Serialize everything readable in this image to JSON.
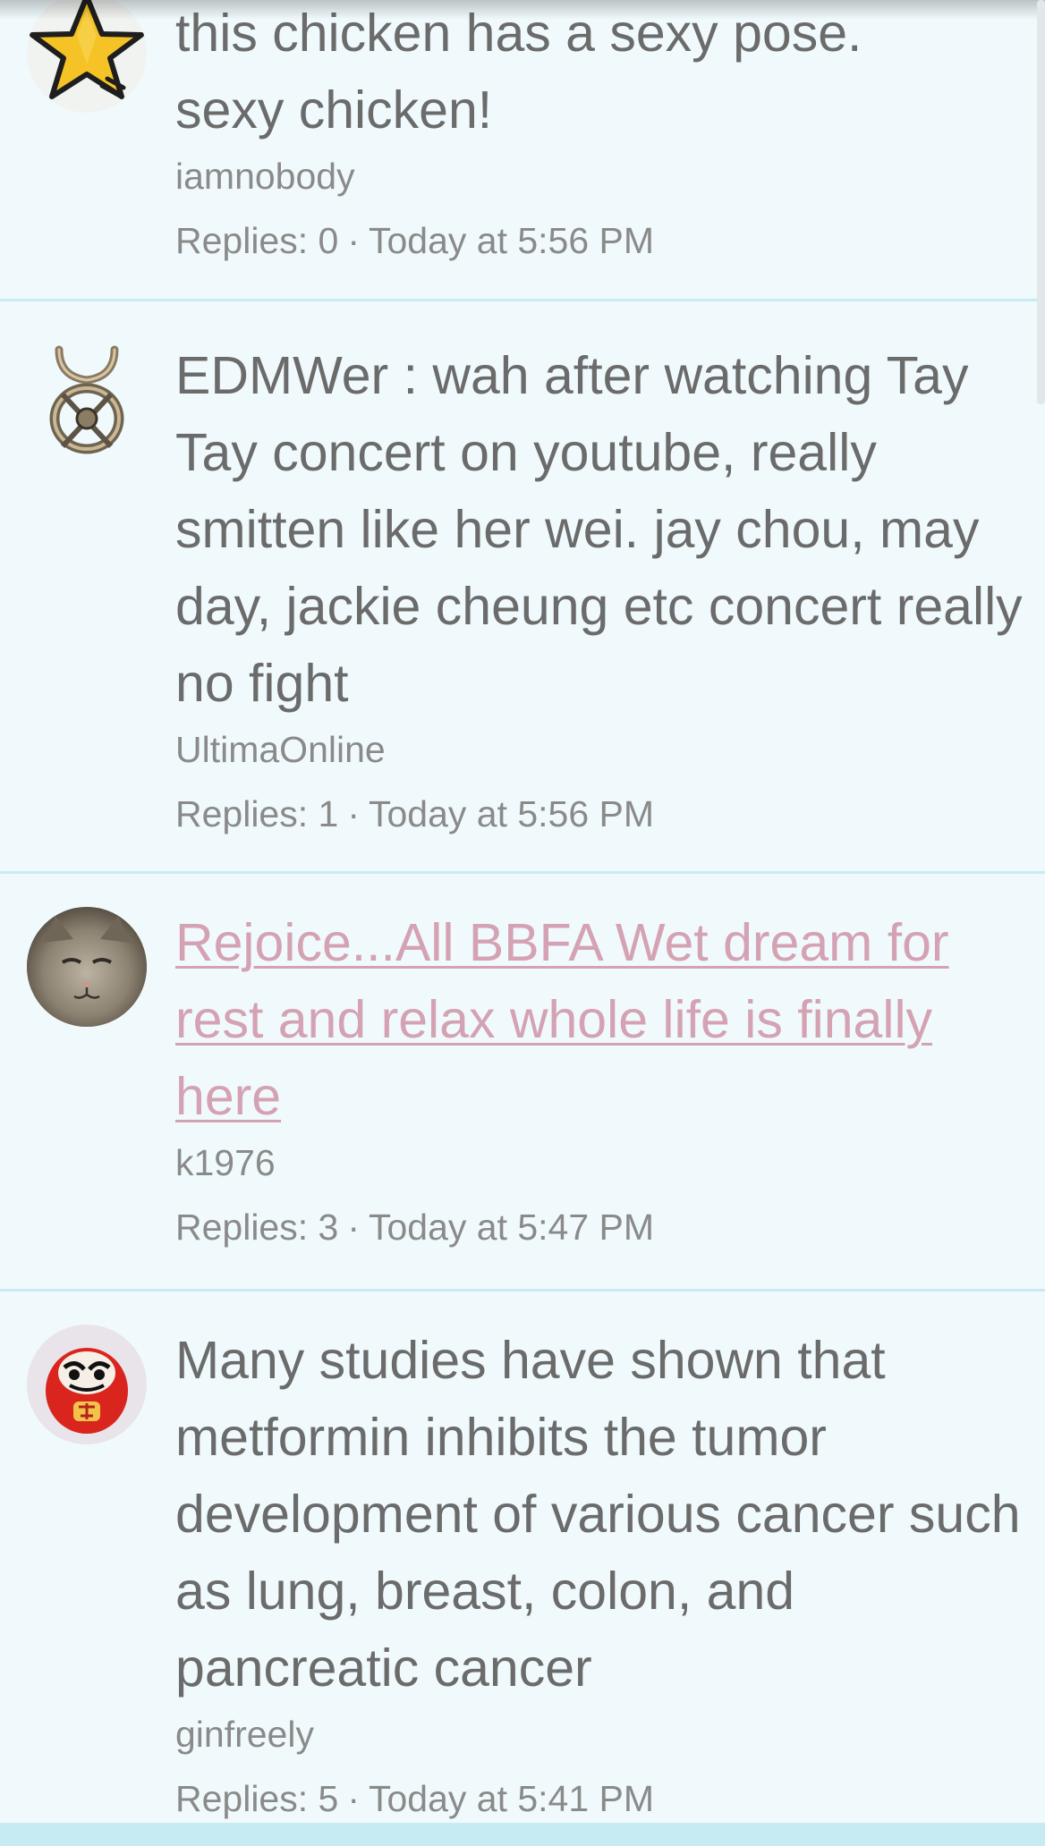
{
  "threads": [
    {
      "title_lines": [
        "this chicken has a sexy pose.",
        "sexy chicken!"
      ],
      "title": "this chicken has a sexy pose. sexy chicken!",
      "is_link": false,
      "author": "iamnobody",
      "replies_label": "Replies: 0",
      "separator": "·",
      "time": "Today at 5:56 PM",
      "avatar_icon": "star-icon"
    },
    {
      "title": "EDMWer : wah after watching Tay Tay concert on youtube, really smitten like her wei. jay chou, may day, jackie cheung etc concert really no fight",
      "is_link": false,
      "author": "UltimaOnline",
      "replies_label": "Replies: 1",
      "separator": "·",
      "time": "Today at 5:56 PM",
      "avatar_icon": "ankh-emblem-icon"
    },
    {
      "title": "Rejoice...All BBFA Wet dream for rest and relax whole life is finally here",
      "is_link": true,
      "author": "k1976",
      "replies_label": "Replies: 3",
      "separator": "·",
      "time": "Today at 5:47 PM",
      "avatar_icon": "cat-photo-icon"
    },
    {
      "title": "Many studies have shown that metformin inhibits the tumor development of various cancer such as lung, breast, colon, and pancreatic cancer",
      "is_link": false,
      "author": "ginfreely",
      "replies_label": "Replies: 5",
      "separator": "·",
      "time": "Today at 5:41 PM",
      "avatar_icon": "daruma-doll-icon"
    }
  ],
  "colors": {
    "background": "#f0fafc",
    "divider": "#c8ebf3",
    "text": "#6b6b6b",
    "meta_text": "#8a8a8a",
    "link": "#d4a2b3",
    "bottom_bar": "#c6ebf2"
  }
}
